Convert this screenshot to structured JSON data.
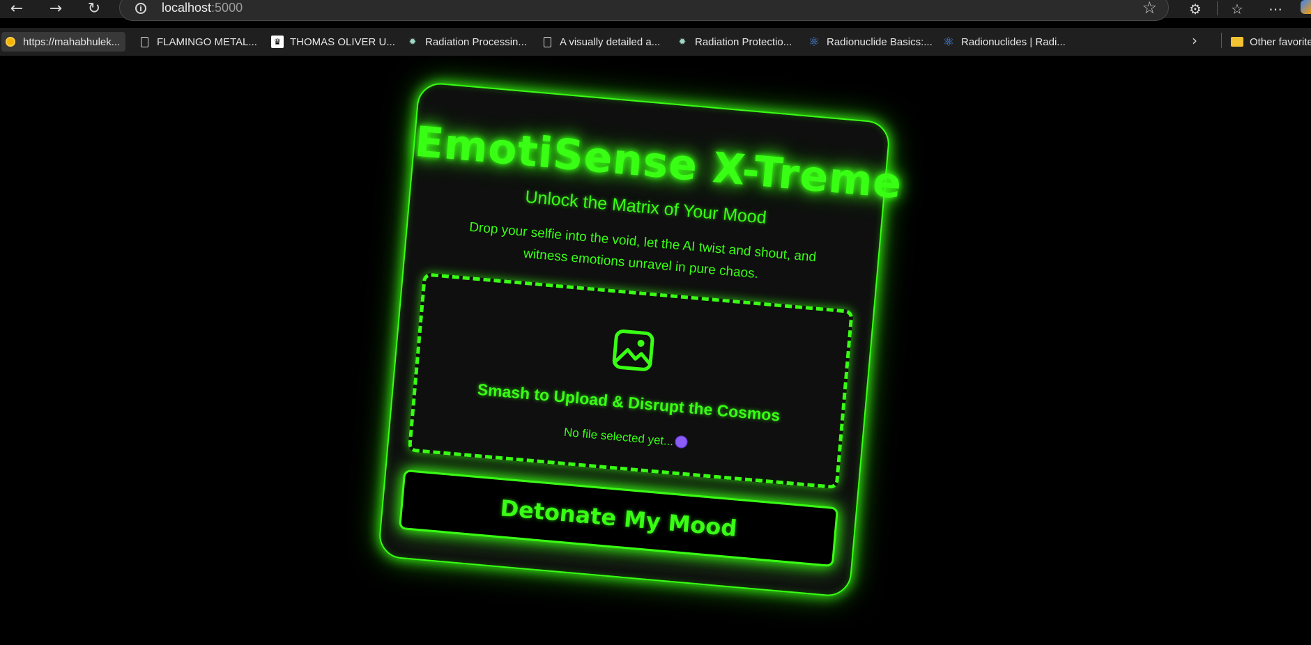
{
  "browser": {
    "url_host": "localhost",
    "url_port": ":5000",
    "icons": {
      "back": "back-arrow-icon",
      "forward": "forward-arrow-icon",
      "reload": "reload-icon",
      "info": "info-icon",
      "favorite": "star-icon",
      "extensions": "puzzle-icon",
      "favorites_list": "favorites-list-icon",
      "menu": "more-icon"
    }
  },
  "bookmarks": {
    "items": [
      {
        "label": "https://mahabhulek...",
        "icon": "sun-icon"
      },
      {
        "label": "FLAMINGO METAL...",
        "icon": "document-icon"
      },
      {
        "label": "THOMAS OLIVER U...",
        "icon": "crown-icon"
      },
      {
        "label": "Radiation Processin...",
        "icon": "gear-icon"
      },
      {
        "label": "A visually detailed a...",
        "icon": "document-icon"
      },
      {
        "label": "Radiation Protectio...",
        "icon": "gear-icon"
      },
      {
        "label": "Radionuclide Basics:...",
        "icon": "atom-icon"
      },
      {
        "label": "Radionuclides | Radi...",
        "icon": "atom-icon"
      }
    ],
    "other": "Other favorite"
  },
  "app": {
    "title": "EmotiSense X-Treme",
    "subtitle": "Unlock the Matrix of Your Mood",
    "description": "Drop your selfie into the void, let the AI twist and shout, and witness emotions unravel in pure chaos.",
    "upload_label": "Smash to Upload & Disrupt the Cosmos",
    "file_status": "No file selected yet...",
    "submit_label": "Detonate My Mood",
    "accent_color": "#39ff14"
  }
}
